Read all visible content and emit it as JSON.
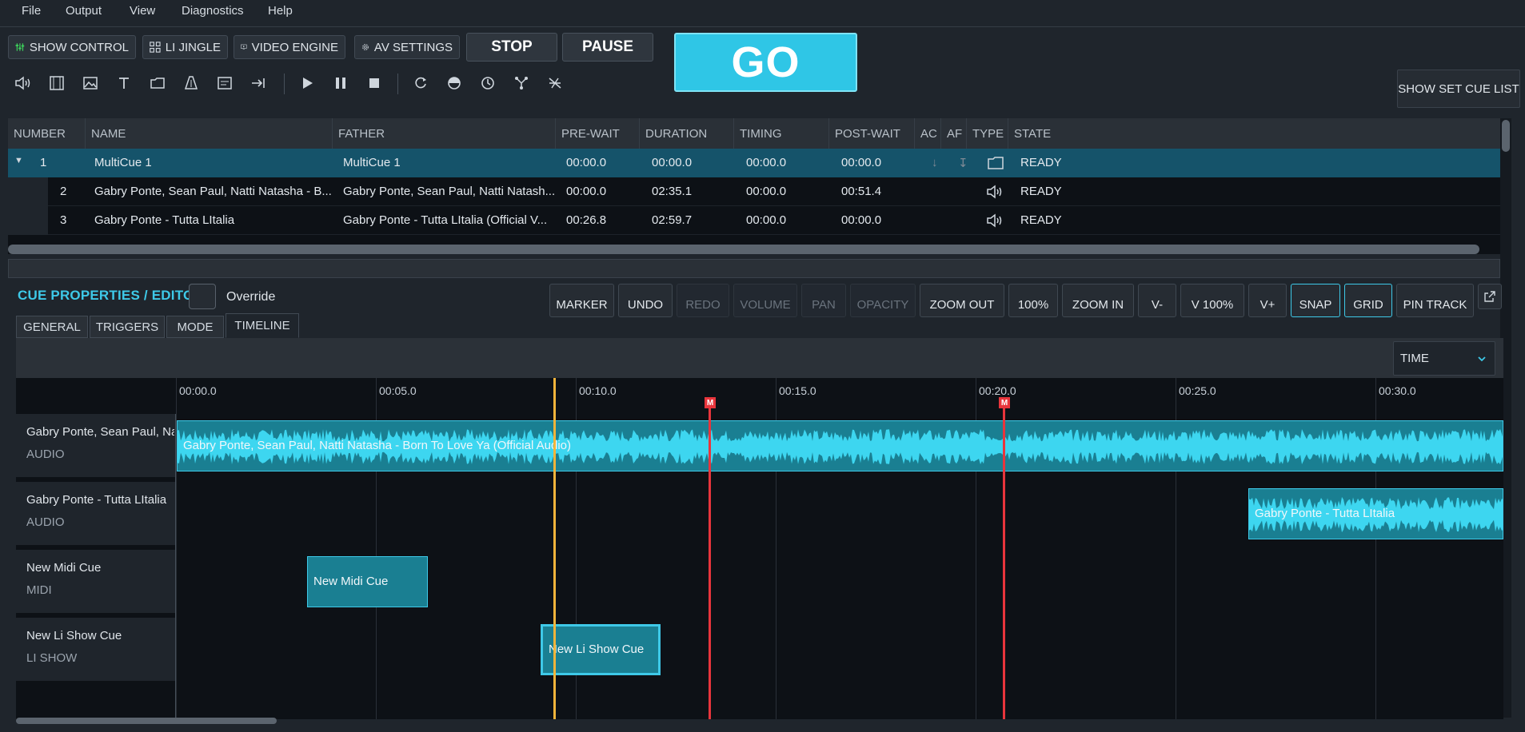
{
  "menu": [
    "File",
    "Output",
    "View",
    "Diagnostics",
    "Help"
  ],
  "toolbar": {
    "show_control": "SHOW CONTROL",
    "li_jingle": "LI JINGLE",
    "video_engine": "VIDEO ENGINE",
    "av_settings": "AV SETTINGS",
    "stop": "STOP",
    "pause": "PAUSE",
    "go": "GO",
    "show_set_cue_list": "SHOW SET CUE LIST"
  },
  "table": {
    "headers": [
      "NUMBER",
      "NAME",
      "FATHER",
      "PRE-WAIT",
      "DURATION",
      "TIMING",
      "POST-WAIT",
      "AC",
      "AF",
      "TYPE",
      "STATE"
    ],
    "rows": [
      {
        "number": "1",
        "name": "MultiCue 1",
        "father": "MultiCue 1",
        "prewait": "00:00.0",
        "duration": "00:00.0",
        "timing": "00:00.0",
        "postwait": "00:00.0",
        "ac": "↓",
        "af": "↧",
        "type": "folder",
        "state": "READY"
      },
      {
        "number": "2",
        "name": "Gabry Ponte, Sean Paul, Natti Natasha - B...",
        "father": "Gabry Ponte, Sean Paul, Natti Natash...",
        "prewait": "00:00.0",
        "duration": "02:35.1",
        "timing": "00:00.0",
        "postwait": "00:51.4",
        "ac": "",
        "af": "",
        "type": "audio",
        "state": "READY"
      },
      {
        "number": "3",
        "name": "Gabry Ponte - Tutta LItalia",
        "father": "Gabry Ponte - Tutta LItalia (Official V...",
        "prewait": "00:26.8",
        "duration": "02:59.7",
        "timing": "00:00.0",
        "postwait": "00:00.0",
        "ac": "",
        "af": "",
        "type": "audio",
        "state": "READY"
      }
    ]
  },
  "editor": {
    "title": "CUE PROPERTIES / EDITOR",
    "override": "Override",
    "buttons": {
      "marker": "MARKER",
      "undo": "UNDO",
      "redo": "REDO",
      "volume": "VOLUME",
      "pan": "PAN",
      "opacity": "OPACITY",
      "zoom_out": "ZOOM OUT",
      "zoom_100": "100%",
      "zoom_in": "ZOOM IN",
      "v_minus": "V-",
      "v_100": "V 100%",
      "v_plus": "V+",
      "snap": "SNAP",
      "grid": "GRID",
      "pin_track": "PIN TRACK"
    },
    "tabs": [
      "GENERAL",
      "TRIGGERS",
      "MODE",
      "TIMELINE"
    ],
    "active_tab": "TIMELINE",
    "time_mode": "TIME"
  },
  "timeline": {
    "ticks": [
      "00:00.0",
      "00:05.0",
      "00:10.0",
      "00:15.0",
      "00:20.0",
      "00:25.0",
      "00:30.0"
    ],
    "marker_label": "M",
    "tracks": [
      {
        "name": "Gabry Ponte, Sean Paul, Natti Natasha - Born To Love Ya (Official Audio)",
        "type": "AUDIO",
        "clip": "Gabry Ponte, Sean Paul, Natti Natasha - Born To Love Ya (Official Audio)"
      },
      {
        "name": "Gabry Ponte - Tutta LItalia",
        "type": "AUDIO",
        "clip": "Gabry Ponte - Tutta LItalia"
      },
      {
        "name": "New Midi Cue",
        "type": "MIDI",
        "clip": "New Midi Cue"
      },
      {
        "name": "New Li Show Cue",
        "type": "LI SHOW",
        "clip": "New Li Show Cue"
      }
    ]
  },
  "colors": {
    "accent": "#3ec9e8",
    "go": "#2fc6e6",
    "marker": "#e8353c",
    "playhead": "#f2b43a",
    "clip": "#1a7f92",
    "selected_row": "#15536a"
  }
}
